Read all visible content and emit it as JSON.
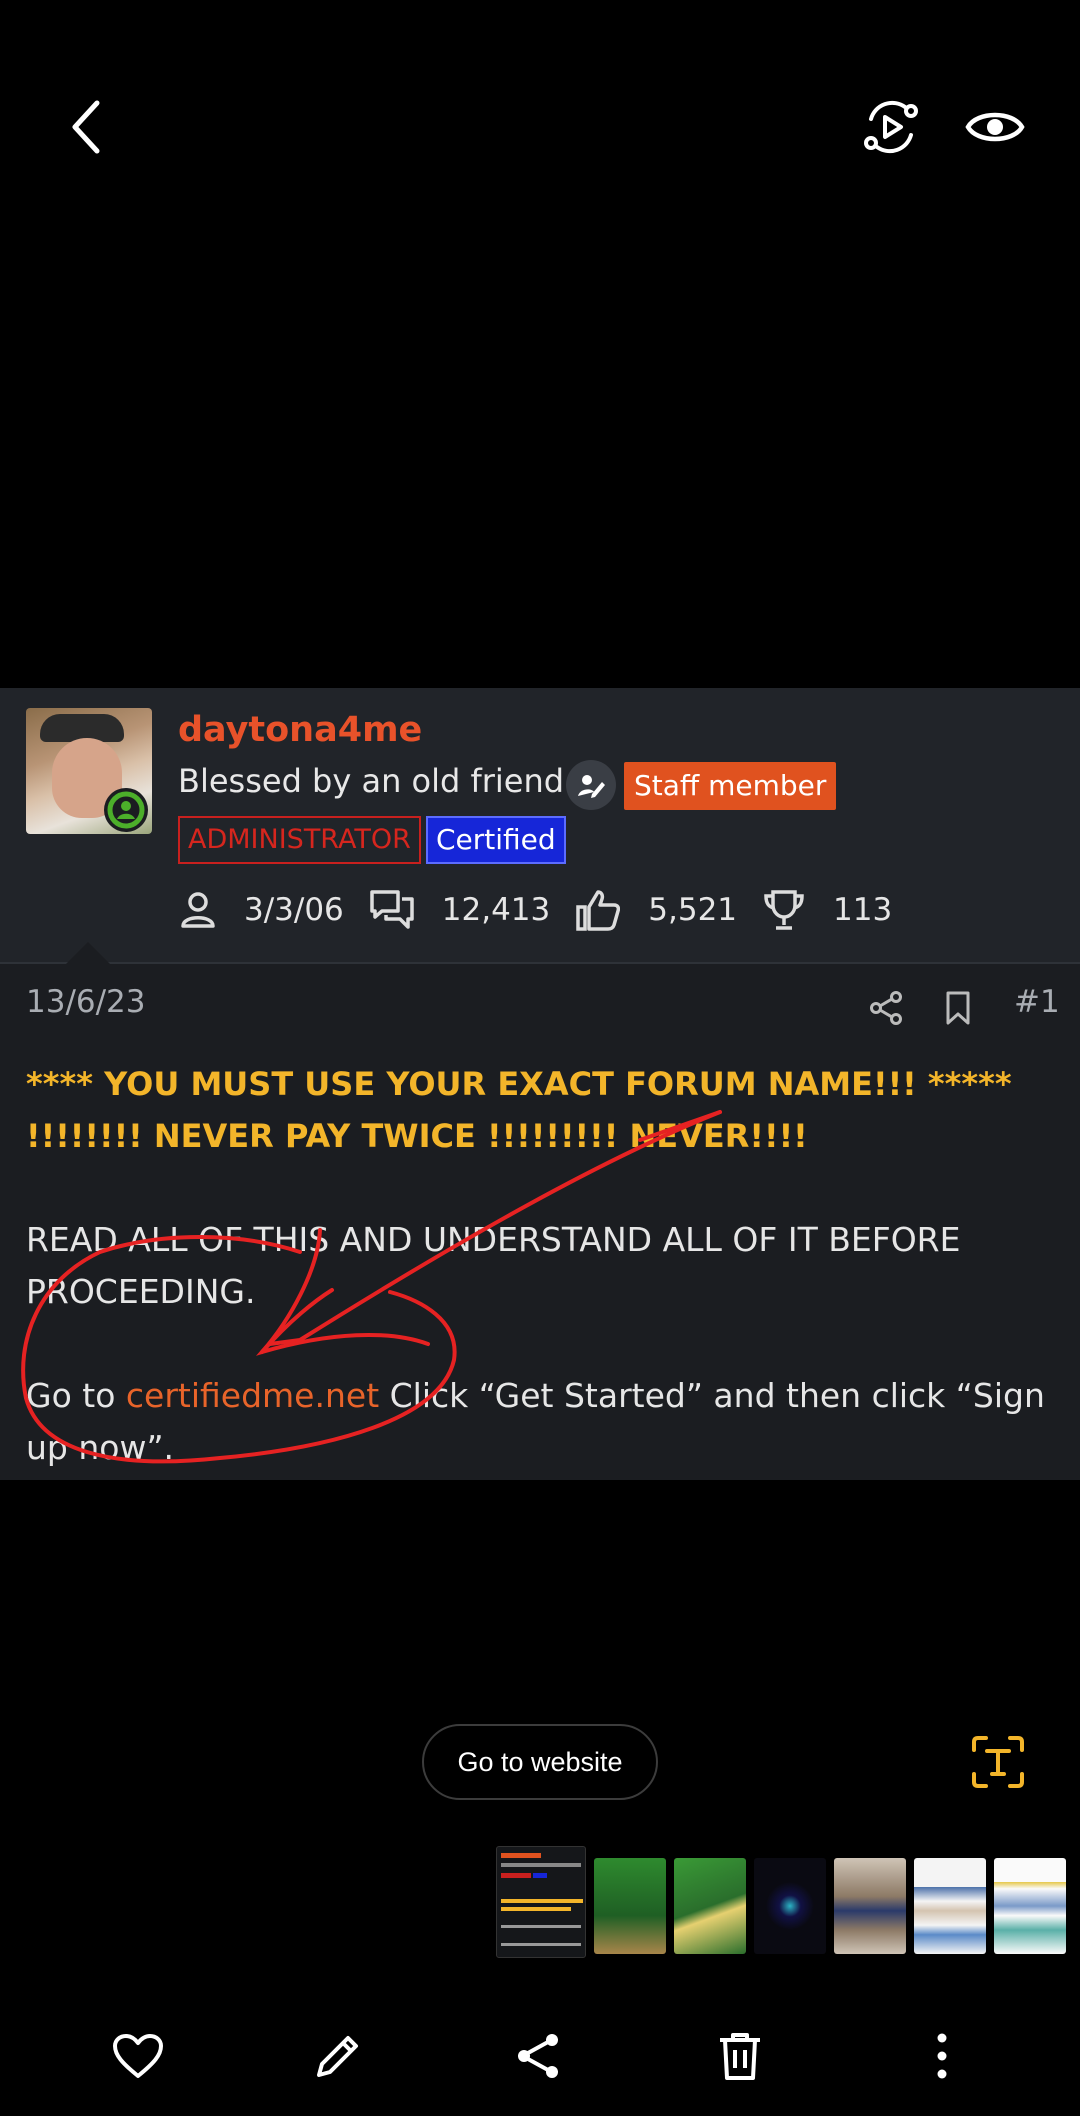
{
  "viewer": {
    "back_icon": "chevron-left-icon",
    "motion_icon": "motion-photo-icon",
    "eye_icon": "eye-icon"
  },
  "author": {
    "username": "daytona4me",
    "user_title": "Blessed by an old friend.",
    "staff_badge": "Staff member",
    "banner_admin": "ADMINISTRATOR",
    "banner_certified": "Certified",
    "stats": {
      "joined": "3/3/06",
      "messages": "12,413",
      "reactions": "5,521",
      "points": "113"
    }
  },
  "post": {
    "date": "13/6/23",
    "number": "#1",
    "warning_line1": "**** YOU MUST USE YOUR EXACT FORUM NAME!!! *****",
    "warning_line2": "!!!!!!!! NEVER PAY TWICE !!!!!!!!! NEVER!!!!",
    "para1": "READ ALL OF THIS AND UNDERSTAND ALL OF IT BEFORE PROCEEDING.",
    "para2_prefix": "Go to ",
    "para2_link": "certifiedme.net",
    "para2_suffix": " Click “Get Started” and then click “Sign up now”."
  },
  "actions": {
    "go_to_website": "Go to website"
  },
  "colors": {
    "username": "#e8522a",
    "warning": "#f3b52a",
    "link": "#e8642a",
    "staff_badge": "#e0521f",
    "certified_badge": "#1626d8",
    "annotation": "#e62222"
  },
  "bottom_bar": [
    "heart-icon",
    "edit-icon",
    "share-icon",
    "delete-icon",
    "more-icon"
  ]
}
